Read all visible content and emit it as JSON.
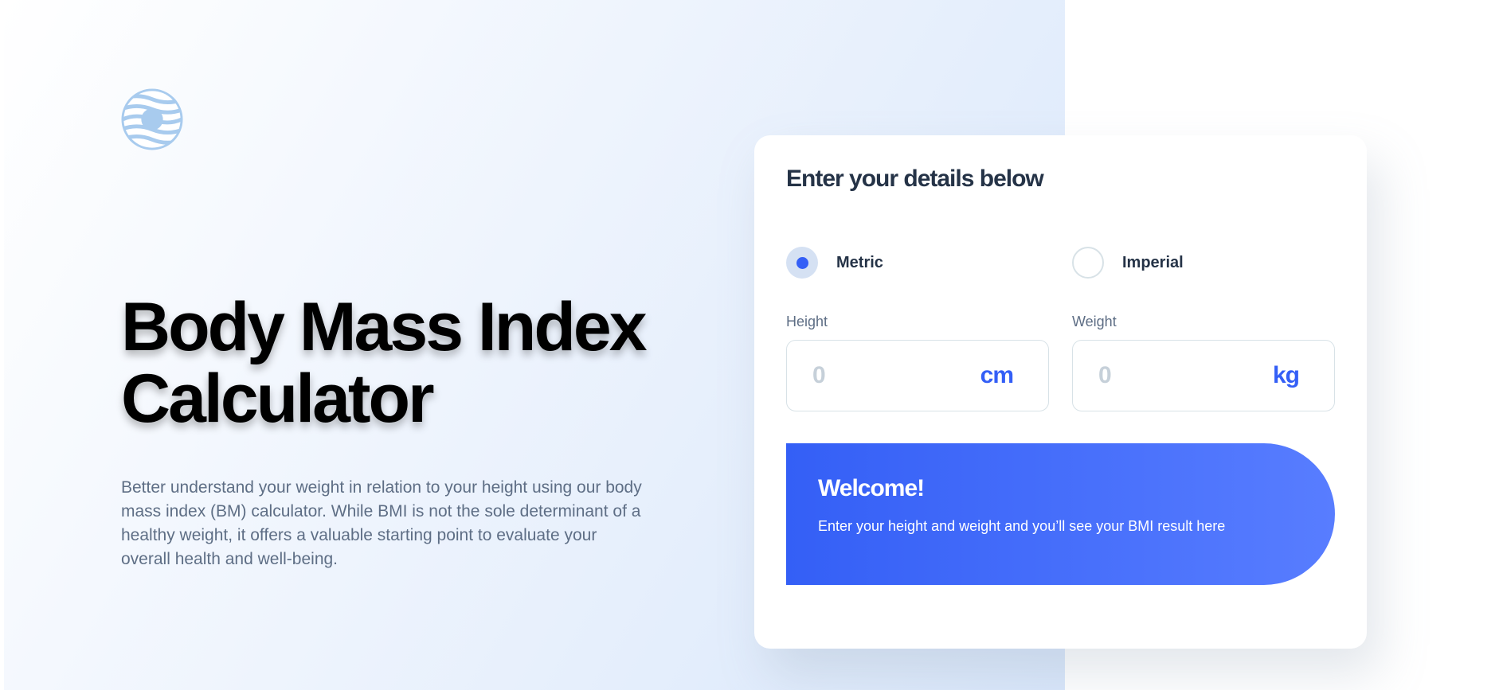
{
  "hero": {
    "logo": "bmi-logo-icon",
    "title_line1": "Body Mass Index",
    "title_line2": "Calculator",
    "description": "Better understand your weight in relation to your height using our body mass index (BM) calculator. While BMI is not the sole determinant of a healthy weight, it offers a valuable starting point to evaluate your overall health and well-being."
  },
  "form": {
    "title": "Enter your details below",
    "units": [
      {
        "label": "Metric",
        "selected": true
      },
      {
        "label": "Imperial",
        "selected": false
      }
    ],
    "height": {
      "label": "Height",
      "placeholder": "0",
      "value": "",
      "unit": "cm"
    },
    "weight": {
      "label": "Weight",
      "placeholder": "0",
      "value": "",
      "unit": "kg"
    }
  },
  "result": {
    "title": "Welcome!",
    "text": "Enter your height and weight and you’ll see your BMI result here"
  },
  "colors": {
    "accent": "#345ff6",
    "heading": "#253347",
    "body_text": "#5e6e85",
    "border": "#d8e2e7"
  }
}
